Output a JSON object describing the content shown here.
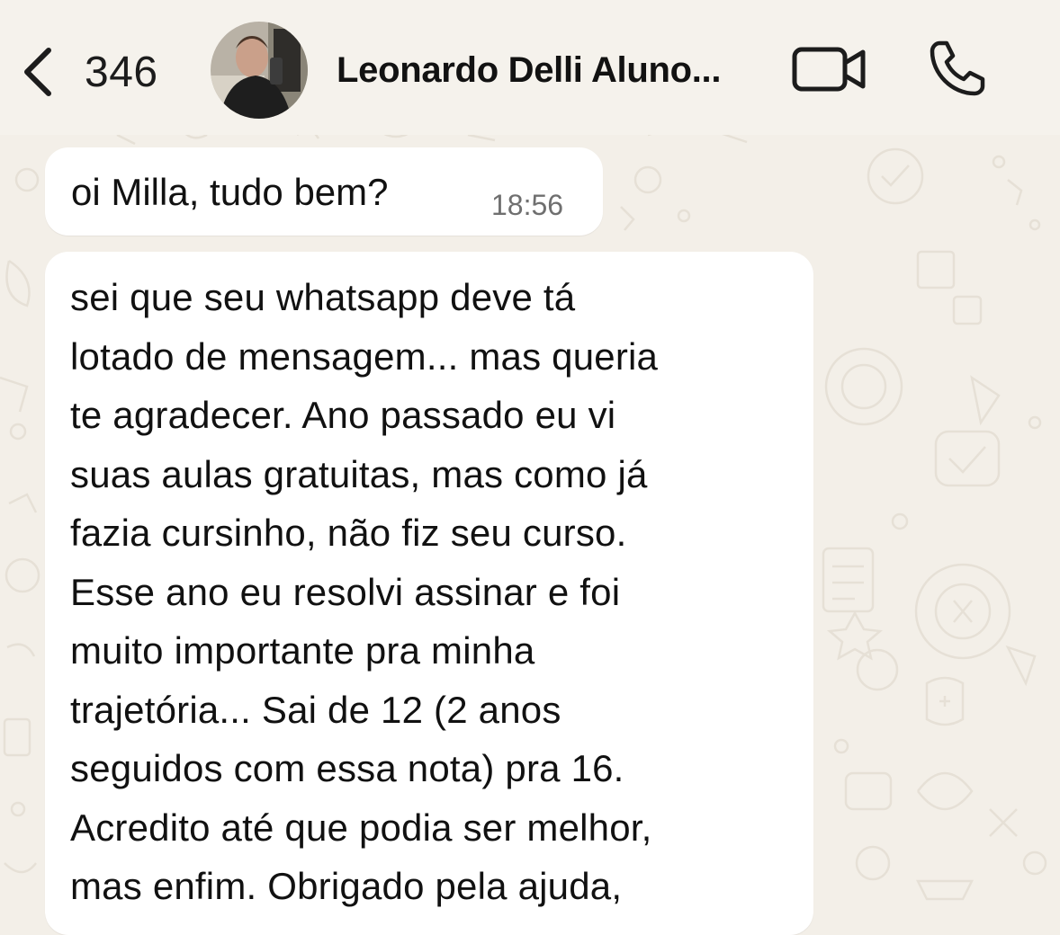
{
  "header": {
    "back_count": "346",
    "contact_name": "Leonardo Delli Aluno...",
    "icons": {
      "back": "chevron-left-icon",
      "video": "video-camera-icon",
      "call": "phone-icon"
    }
  },
  "messages": [
    {
      "text": "oi Milla, tudo bem?",
      "time": "18:56"
    },
    {
      "lines": [
        "sei que seu whatsapp deve tá",
        "lotado de mensagem... mas queria",
        "te agradecer. Ano passado eu vi",
        "suas aulas gratuitas, mas como já",
        "fazia cursinho, não fiz seu curso.",
        "Esse ano eu resolvi assinar e foi",
        "muito importante pra minha",
        "trajetória... Sai de 12 (2 anos",
        "seguidos com essa nota) pra 16.",
        "Acredito até que podia ser melhor,",
        "mas enfim. Obrigado pela ajuda,"
      ]
    }
  ],
  "colors": {
    "chat_background": "#f3efe8",
    "bubble": "#ffffff",
    "text": "#111111",
    "timestamp": "#6f6f6f"
  }
}
